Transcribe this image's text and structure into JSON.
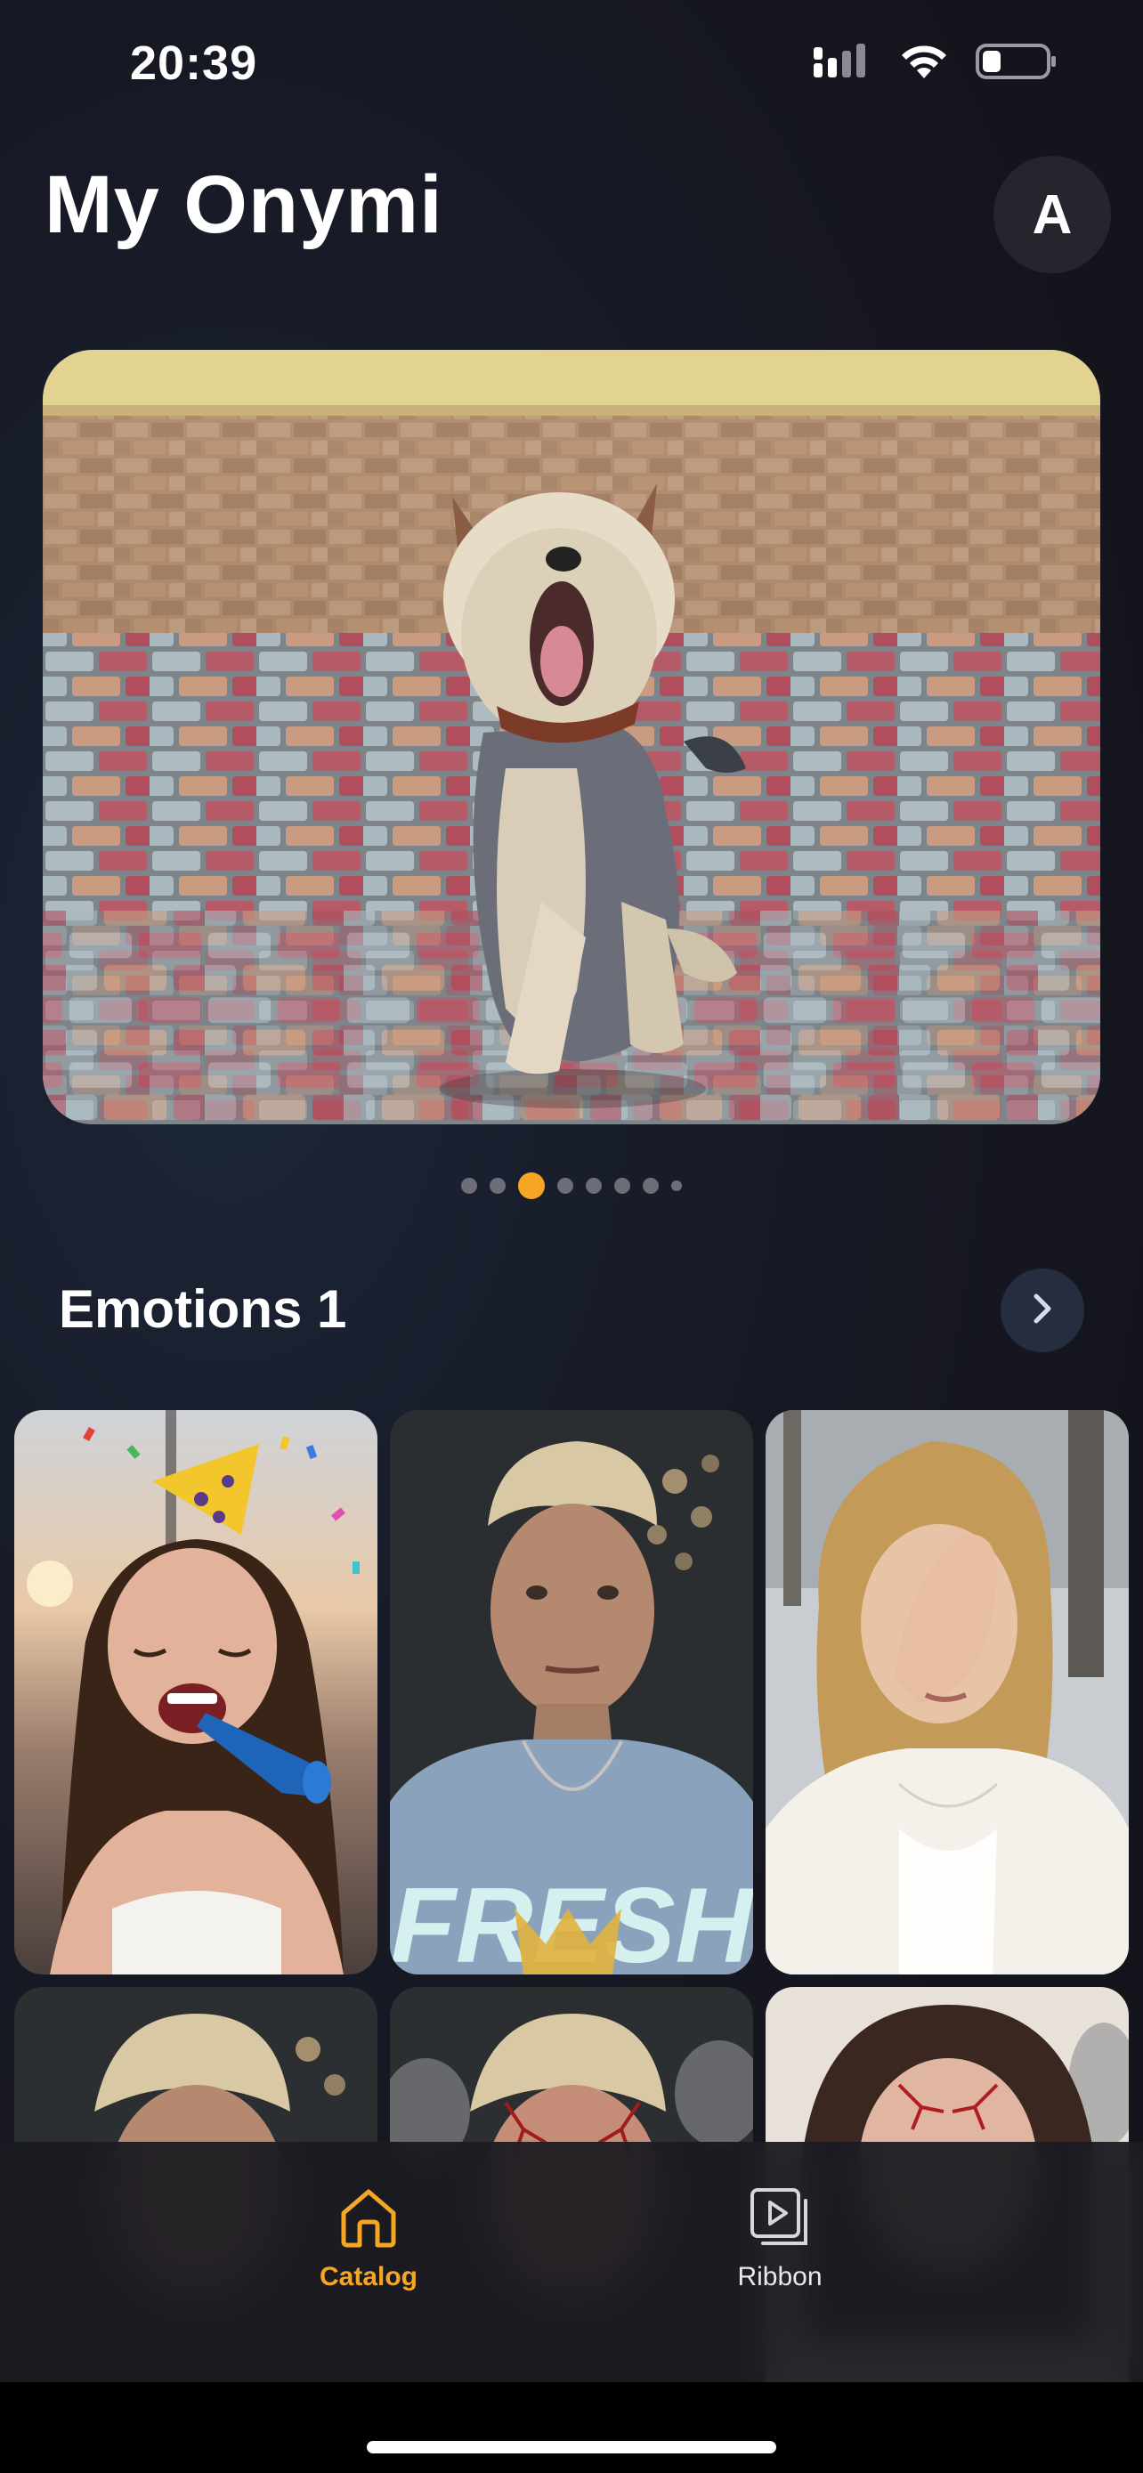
{
  "status_bar": {
    "time": "20:39",
    "icons": [
      "cellular-signal-icon",
      "wifi-icon",
      "battery-icon"
    ]
  },
  "header": {
    "title": "My Onymi",
    "avatar_initial": "A"
  },
  "hero": {
    "image": "yawning-terrier-on-brick-pavement",
    "pager_count": 8,
    "pager_active_index": 2
  },
  "section": {
    "title": "Emotions 1",
    "more_icon": "chevron-right-icon",
    "items": [
      {
        "image": "woman-laughing-party-hat"
      },
      {
        "image": "man-in-fresh-tshirt"
      },
      {
        "image": "woman-covering-eyes"
      },
      {
        "image": "blond-man-partial"
      },
      {
        "image": "blond-man-red-veins-smoke"
      },
      {
        "image": "woman-red-veins-forehead"
      }
    ]
  },
  "tab_bar": {
    "tabs": [
      {
        "label": "Catalog",
        "icon": "home-icon",
        "active": true
      },
      {
        "label": "Ribbon",
        "icon": "play-stack-icon",
        "active": false
      }
    ]
  },
  "colors": {
    "accent": "#f6a623",
    "background": "#14141c"
  }
}
